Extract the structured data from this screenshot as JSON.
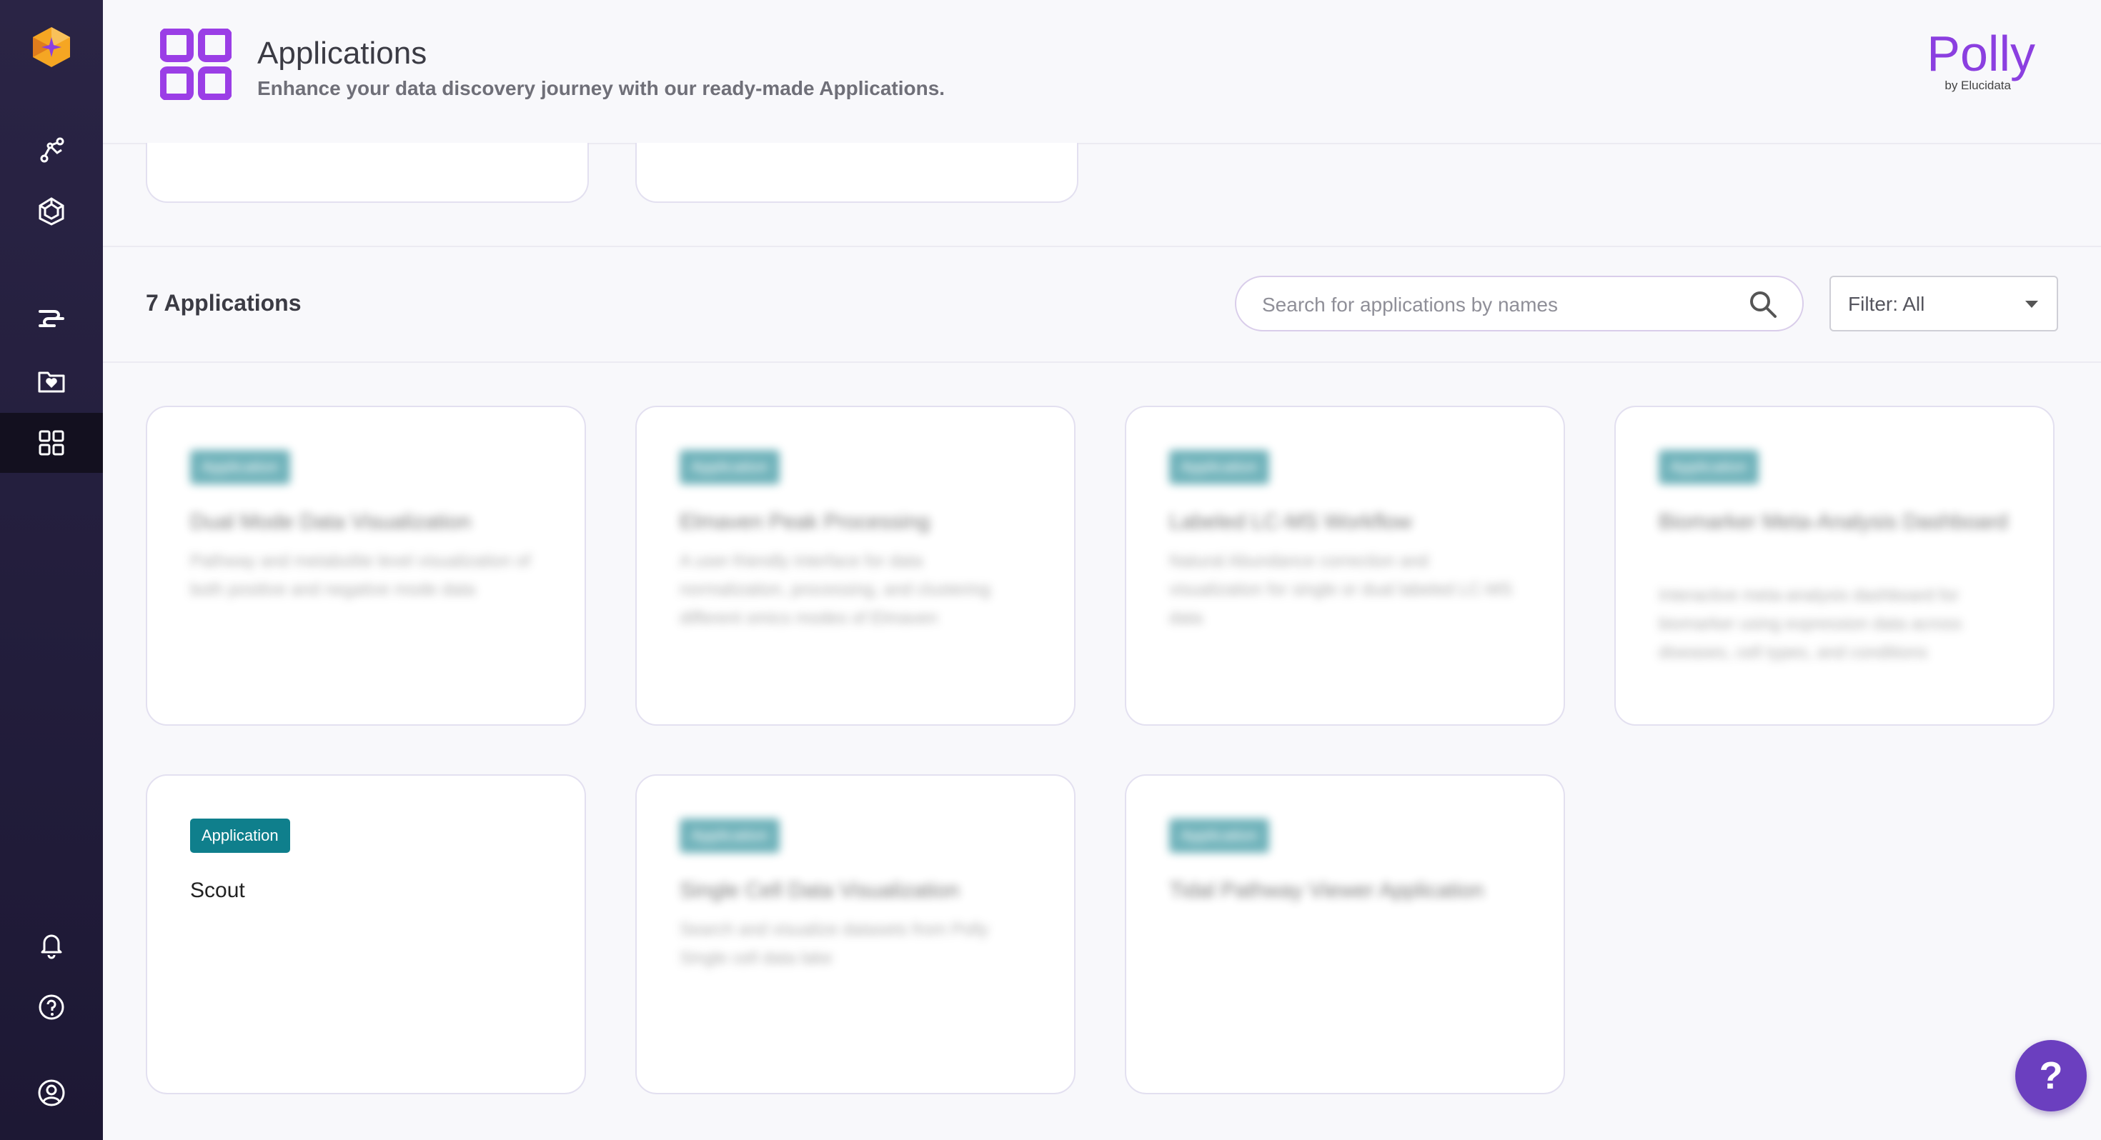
{
  "header": {
    "title": "Applications",
    "subtitle": "Enhance your data discovery journey with our ready-made Applications.",
    "brand": "Polly",
    "brand_sub": "by Elucidata"
  },
  "toolbar": {
    "count_label": "7 Applications",
    "search_placeholder": "Search for applications by names",
    "search_value": "",
    "filter_label": "Filter: All"
  },
  "colors": {
    "accent": "#8b3fe0",
    "badge": "#0f7f8c",
    "sidebar": "#241f3e",
    "help_button": "#6b3fbf"
  },
  "sidebar_icons": [
    "polly-logo",
    "pipeline-icon",
    "atlas-icon",
    "workflow-icon",
    "favorites-folder-icon",
    "applications-grid-icon",
    "bell-icon",
    "help-circle-icon",
    "user-icon"
  ],
  "cards": [
    {
      "badge": "Application",
      "title": "Dual Mode Data Visualization",
      "desc": "Pathway and metabolite level visualization of both positive and negative mode data"
    },
    {
      "badge": "Application",
      "title": "Elmaven Peak Processing",
      "desc": "A user-friendly interface for data normalization, processing, and clustering different omics modes of Elmaven"
    },
    {
      "badge": "Application",
      "title": "Labeled LC-MS Workflow",
      "desc": "Natural Abundance correction and visualization for single or dual labeled LC-MS data"
    },
    {
      "badge": "Application",
      "title": "Biomarker Meta-Analysis Dashboard",
      "desc": "Interactive meta-analysis dashboard for biomarker using expression data across diseases, cell types, and conditions"
    },
    {
      "badge": "Application",
      "title": "Scout",
      "desc": ""
    },
    {
      "badge": "Application",
      "title": "Single Cell Data Visualization",
      "desc": "Search and visualize datasets from Polly Single cell data lake"
    },
    {
      "badge": "Application",
      "title": "Tidal Pathway Viewer Application",
      "desc": ""
    }
  ]
}
